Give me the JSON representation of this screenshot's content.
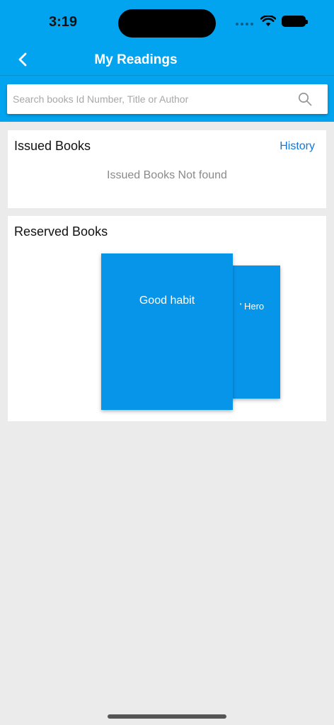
{
  "status_bar": {
    "time": "3:19"
  },
  "nav": {
    "title": "My Readings",
    "back_icon": "chevron-left-icon"
  },
  "search": {
    "placeholder": "Search books Id Number, Title or Author",
    "icon": "search-icon"
  },
  "issued": {
    "title": "Issued Books",
    "history_label": "History",
    "empty_message": "Issued Books Not found"
  },
  "reserved": {
    "title": "Reserved Books",
    "books": [
      {
        "title": "Good habit"
      },
      {
        "title": "' Hero"
      }
    ]
  },
  "colors": {
    "header": "#02a4ef",
    "book": "#0795ea",
    "link": "#1377d4",
    "background": "#ebebeb"
  }
}
